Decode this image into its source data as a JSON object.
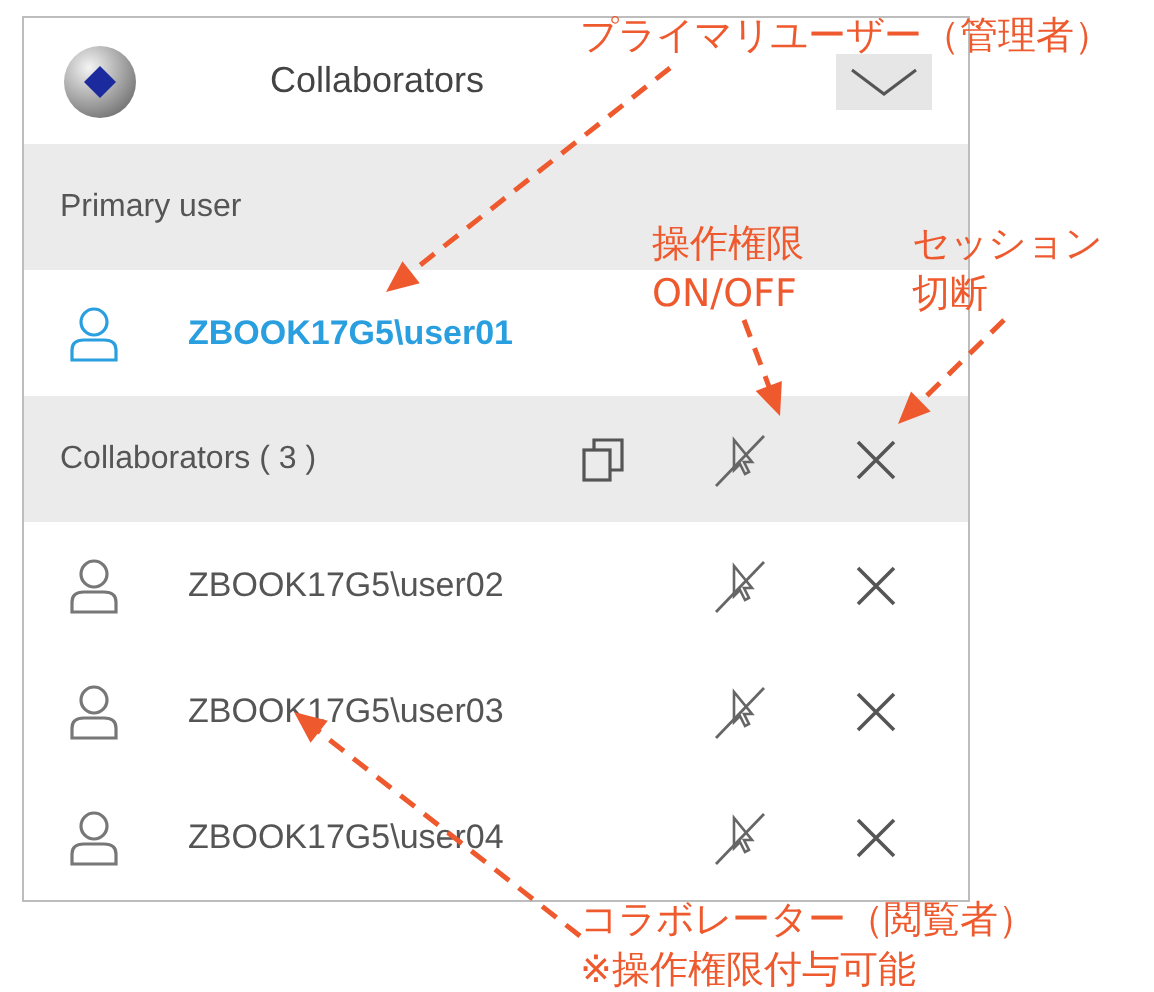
{
  "panel": {
    "title": "Collaborators",
    "primary_label": "Primary user",
    "primary_user": "ZBOOK17G5\\user01",
    "collaborators_label": "Collaborators ( 3 )",
    "users": [
      {
        "name": "ZBOOK17G5\\user02"
      },
      {
        "name": "ZBOOK17G5\\user03"
      },
      {
        "name": "ZBOOK17G5\\user04"
      }
    ]
  },
  "annotations": [
    {
      "lines": [
        "プライマリユーザー（管理者）"
      ]
    },
    {
      "lines": [
        "操作権限",
        "ON/OFF"
      ]
    },
    {
      "lines": [
        "セッション",
        "切断"
      ]
    },
    {
      "lines": [
        "コラボレーター（閲覧者）",
        "※操作権限付与可能"
      ]
    }
  ]
}
